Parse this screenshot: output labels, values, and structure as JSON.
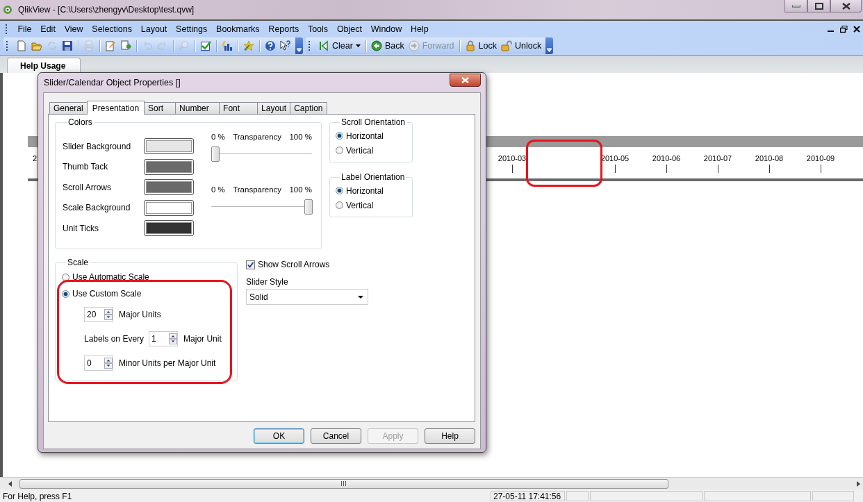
{
  "app_window": {
    "title": "QlikView - [C:\\Users\\zhengyv\\Desktop\\test.qvw]"
  },
  "menu": [
    "File",
    "Edit",
    "View",
    "Selections",
    "Layout",
    "Settings",
    "Bookmarks",
    "Reports",
    "Tools",
    "Object",
    "Window",
    "Help"
  ],
  "toolbar": {
    "groups": [
      {
        "items": [
          {
            "kind": "new",
            "disabled": false
          },
          {
            "kind": "open",
            "disabled": false
          },
          {
            "kind": "reload",
            "disabled": true
          },
          {
            "kind": "save",
            "disabled": false
          }
        ]
      },
      {
        "items": [
          {
            "kind": "print",
            "disabled": true
          }
        ]
      },
      {
        "items": [
          {
            "kind": "edit",
            "disabled": false
          },
          {
            "kind": "export",
            "disabled": false
          }
        ]
      },
      {
        "items": [
          {
            "kind": "undo",
            "disabled": true
          },
          {
            "kind": "redo",
            "disabled": true
          }
        ]
      },
      {
        "items": [
          {
            "kind": "search",
            "disabled": true
          }
        ]
      },
      {
        "items": [
          {
            "kind": "check",
            "disabled": false
          }
        ]
      },
      {
        "items": [
          {
            "kind": "chart",
            "disabled": false
          }
        ]
      },
      {
        "items": [
          {
            "kind": "star",
            "disabled": false
          }
        ]
      },
      {
        "items": [
          {
            "kind": "help",
            "disabled": false
          },
          {
            "kind": "pointer",
            "disabled": false
          }
        ]
      }
    ]
  },
  "selection_toolbar": {
    "groups": [
      {
        "items": [
          {
            "kind": "clear",
            "label": "Clear",
            "disabled": false,
            "dropdown": true
          }
        ]
      },
      {
        "items": [
          {
            "kind": "back",
            "label": "Back",
            "disabled": false,
            "dropdown": false
          },
          {
            "kind": "forward",
            "label": "Forward",
            "disabled": true,
            "dropdown": false
          }
        ]
      },
      {
        "items": [
          {
            "kind": "lock",
            "label": "Lock",
            "disabled": false,
            "dropdown": false
          },
          {
            "kind": "unlock",
            "label": "Unlock",
            "disabled": false,
            "dropdown": false
          }
        ]
      }
    ]
  },
  "sheet_tabs": [
    {
      "label": "Help Usage",
      "selected": true
    }
  ],
  "slider_object": {
    "cut_label": "2",
    "labels_before_gap": [
      "2010-03"
    ],
    "labels_after_gap": [
      "2010-05",
      "2010-06",
      "2010-07",
      "2010-08",
      "2010-09"
    ]
  },
  "dialog": {
    "title": "Slider/Calendar Object Properties []",
    "tabs": [
      {
        "label": "General",
        "selected": false
      },
      {
        "label": "Presentation",
        "selected": true
      },
      {
        "label": "Sort",
        "selected": false
      },
      {
        "label": "Number",
        "selected": false
      },
      {
        "label": "Font",
        "selected": false
      },
      {
        "label": "Layout",
        "selected": false
      },
      {
        "label": "Caption",
        "selected": false
      }
    ],
    "colors": {
      "title": "Colors",
      "rows": [
        {
          "label": "Slider Background",
          "color": "#e6e6e6"
        },
        {
          "label": "Thumb Tack",
          "color": "#6a6a6a"
        },
        {
          "label": "Scroll Arrows",
          "color": "#6a6a6a"
        },
        {
          "label": "Scale Background",
          "color": "#ffffff"
        },
        {
          "label": "Unit Ticks",
          "color": "#333333"
        }
      ],
      "transparency": [
        {
          "min_label": "0 %",
          "title": "Transparency",
          "max_label": "100 %",
          "level": 0
        },
        {
          "min_label": "0 %",
          "title": "Transparency",
          "max_label": "100 %",
          "level": 1
        }
      ]
    },
    "scroll_orientation": {
      "title": "Scroll Orientation",
      "options": [
        {
          "label": "Horizontal",
          "selected": true
        },
        {
          "label": "Vertical",
          "selected": false
        }
      ]
    },
    "label_orientation": {
      "title": "Label Orientation",
      "options": [
        {
          "label": "Horizontal",
          "selected": true
        },
        {
          "label": "Vertical",
          "selected": false
        }
      ]
    },
    "scale": {
      "title": "Scale",
      "options": [
        {
          "label": "Use Automatic Scale",
          "selected": false
        },
        {
          "label": "Use Custom Scale",
          "selected": true
        }
      ],
      "fields": [
        {
          "value": "20",
          "after": "Major Units"
        },
        {
          "before": "Labels on Every",
          "value": "1",
          "after": "Major Unit"
        },
        {
          "value": "0",
          "after": "Minor Units per Major Unit"
        }
      ]
    },
    "show_scroll_arrows": {
      "label": "Show Scroll Arrows",
      "checked": true
    },
    "slider_style": {
      "label": "Slider Style",
      "value": "Solid"
    },
    "buttons": [
      {
        "label": "OK",
        "default": true,
        "disabled": false
      },
      {
        "label": "Cancel",
        "default": false,
        "disabled": false
      },
      {
        "label": "Apply",
        "default": false,
        "disabled": true
      },
      {
        "label": "Help",
        "default": false,
        "disabled": false
      }
    ]
  },
  "status_bar": {
    "help": "For Help, press F1",
    "datetime": "27-05-11 17:41:56"
  }
}
